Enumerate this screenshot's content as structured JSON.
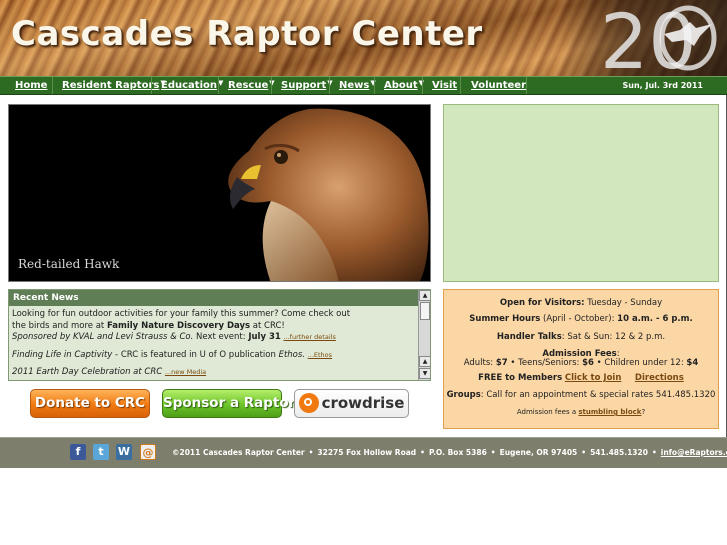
{
  "header": {
    "title": "Cascades Raptor Center",
    "anniversary_number": "20"
  },
  "nav": {
    "items": [
      {
        "label": "Home",
        "has_dropdown": false
      },
      {
        "label": "Resident Raptors",
        "has_dropdown": true
      },
      {
        "label": "Education",
        "has_dropdown": true
      },
      {
        "label": "Rescue",
        "has_dropdown": true
      },
      {
        "label": "Support",
        "has_dropdown": true
      },
      {
        "label": "News",
        "has_dropdown": true
      },
      {
        "label": "About",
        "has_dropdown": true
      },
      {
        "label": "Visit",
        "has_dropdown": false
      },
      {
        "label": "Volunteer",
        "has_dropdown": false
      }
    ],
    "date": "Sun, Jul. 3rd 2011"
  },
  "hero": {
    "caption": "Red-tailed Hawk"
  },
  "news": {
    "heading": "Recent News",
    "item1_line1": "Looking for fun outdoor activities for your family this summer? Come check out",
    "item1_line2_pre": "the birds and more at ",
    "item1_line2_bold": "Family Nature Discovery Days",
    "item1_line2_post": " at CRC!",
    "item1_line3_italic": "Sponsored by KVAL and Levi Strauss & Co.",
    "item1_line3_mid": "  Next event: ",
    "item1_line3_bold": "July 31",
    "item1_link": "...further details",
    "item2_italic": "Finding Life in Captivity",
    "item2_mid": " - CRC is featured in U of O publication ",
    "item2_pub": "Ethos.",
    "item2_link": "...Ethos",
    "item3_italic": "2011 Earth Day Celebration at CRC",
    "item3_link": "...new Media"
  },
  "buttons": {
    "donate": "Donate to CRC",
    "sponsor": "Sponsor a Raptor",
    "crowdrise": "crowdrise"
  },
  "info": {
    "open_label": "Open for Visitors:",
    "open_value": " Tuesday - Sunday",
    "summer_label": "Summer Hours",
    "summer_mid": " (April - October): ",
    "summer_value": "10 a.m. - 6 p.m.",
    "handler_label": "Handler Talks",
    "handler_value": ": Sat & Sun: 12 & 2 p.m.",
    "fees_label": "Admission Fees",
    "fees_colon": ":",
    "fees_adults_pre": "Adults: ",
    "fees_adults": "$7",
    "fees_teens_pre": " • Teens/Seniors: ",
    "fees_teens": "$6",
    "fees_children_pre": " • Children under 12: ",
    "fees_children": "$4",
    "members_label": "FREE to Members",
    "join_link": "Click to Join",
    "directions_link": "Directions",
    "groups_label": "Groups",
    "groups_value": ": Call for an appointment & special rates 541.485.1320",
    "stumbling_pre": "Admission fees a ",
    "stumbling_link": "stumbling block",
    "stumbling_post": "?"
  },
  "footer": {
    "copyright": "©2011 Cascades Raptor Center",
    "address": "32275 Fox Hollow Road",
    "pobox": "P.O. Box 5386",
    "city": "Eugene, OR 97405",
    "phone": "541.485.1320",
    "email": "info@eRaptors.org",
    "social": [
      "facebook-icon",
      "twitter-icon",
      "wordpress-icon",
      "other-icon"
    ]
  },
  "colors": {
    "nav_green": "#2e6b22",
    "green_box": "#d3e7bf",
    "info_box": "#fbd7a6",
    "footer_gray": "#7e7e6c"
  }
}
